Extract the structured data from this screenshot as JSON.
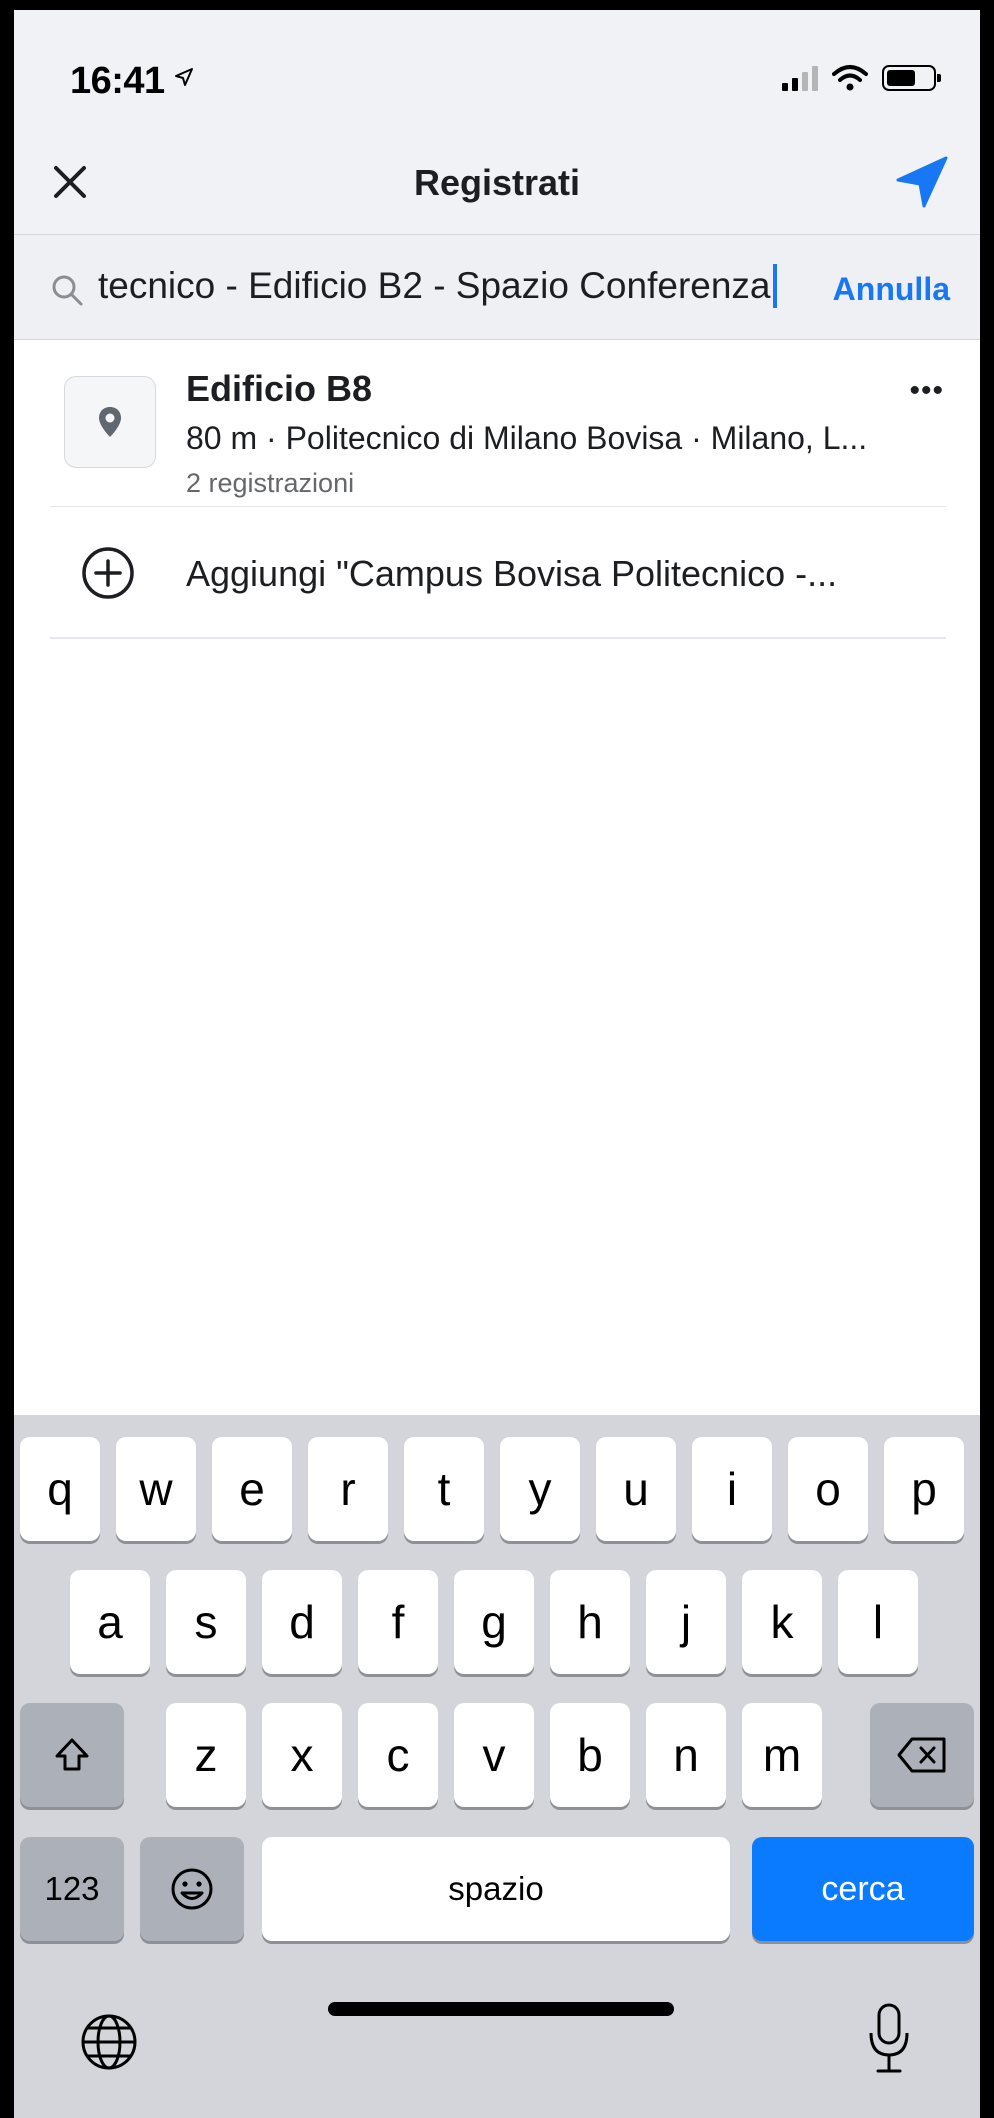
{
  "status_bar": {
    "time": "16:41"
  },
  "header": {
    "title": "Registrati"
  },
  "search": {
    "query": "tecnico -  Edificio B2 - Spazio Conferenza",
    "cancel_label": "Annulla"
  },
  "results": [
    {
      "name": "Edificio B8",
      "subtitle": "80 m · Politecnico di Milano Bovisa · Milano, L...",
      "count": "2 registrazioni"
    }
  ],
  "add_place": {
    "label": "Aggiungi \"Campus Bovisa Politecnico -..."
  },
  "keyboard": {
    "row1": [
      "q",
      "w",
      "e",
      "r",
      "t",
      "y",
      "u",
      "i",
      "o",
      "p"
    ],
    "row2": [
      "a",
      "s",
      "d",
      "f",
      "g",
      "h",
      "j",
      "k",
      "l"
    ],
    "row3": [
      "z",
      "x",
      "c",
      "v",
      "b",
      "n",
      "m"
    ],
    "numbers_label": "123",
    "space_label": "spazio",
    "return_label": "cerca"
  },
  "colors": {
    "accent": "#1877f2",
    "keyboard_return": "#0a7aff"
  }
}
